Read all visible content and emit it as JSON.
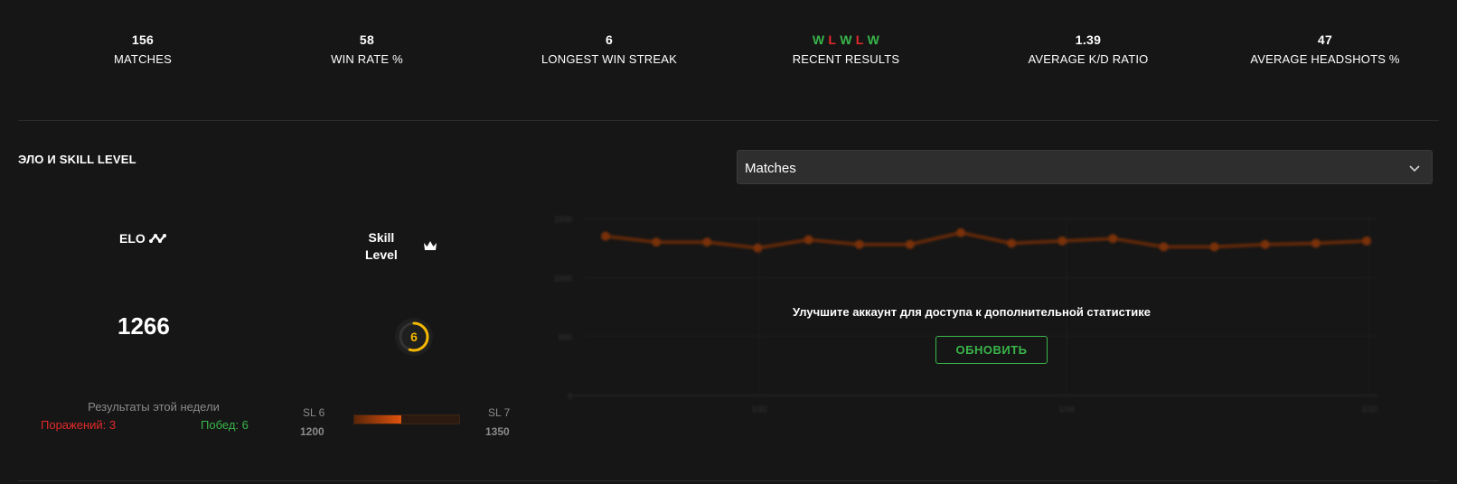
{
  "stats": [
    {
      "value": "156",
      "label": "MATCHES"
    },
    {
      "value": "58",
      "label": "WIN RATE %"
    },
    {
      "value": "6",
      "label": "LONGEST WIN STREAK"
    },
    {
      "value": "",
      "label": "RECENT RESULTS"
    },
    {
      "value": "1.39",
      "label": "AVERAGE K/D RATIO"
    },
    {
      "value": "47",
      "label": "AVERAGE HEADSHOTS %"
    }
  ],
  "recent_results": [
    "W",
    "L",
    "W",
    "L",
    "W"
  ],
  "section_title": "ЭЛО И SKILL LEVEL",
  "chart_select": {
    "selected": "Matches"
  },
  "elo": {
    "title": "ELO",
    "value": "1266"
  },
  "skill": {
    "title_line1": "Skill",
    "title_line2": "Level",
    "level": "6",
    "gauge_fraction": 0.55
  },
  "week": {
    "title": "Результаты этой недели",
    "losses": "Поражений: 3",
    "wins": "Побед: 6"
  },
  "progress": {
    "sl_from": "SL 6",
    "sl_to": "SL 7",
    "elo_from": "1200",
    "elo_to": "1350",
    "fraction": 0.45
  },
  "upgrade": {
    "message": "Улучшите аккаунт для доступа к дополнительной статистике",
    "button": "ОБНОВИТЬ"
  },
  "colors": {
    "win": "#39b54a",
    "loss": "#e32a2a",
    "accent": "#e0520d",
    "gauge": "#f5b800"
  },
  "chart_data": {
    "type": "line",
    "title": "",
    "xlabel": "",
    "ylabel": "",
    "y_ticks": [
      "0",
      "500",
      "1000",
      "1500"
    ],
    "x_ticks": [
      "1/32",
      "1/16",
      "1/10"
    ],
    "ylim": [
      0,
      1500
    ],
    "series": [
      {
        "values": [
          1350,
          1300,
          1300,
          1250,
          1320,
          1280,
          1280,
          1380,
          1290,
          1310,
          1330,
          1260,
          1260,
          1280,
          1290,
          1310
        ]
      }
    ]
  }
}
